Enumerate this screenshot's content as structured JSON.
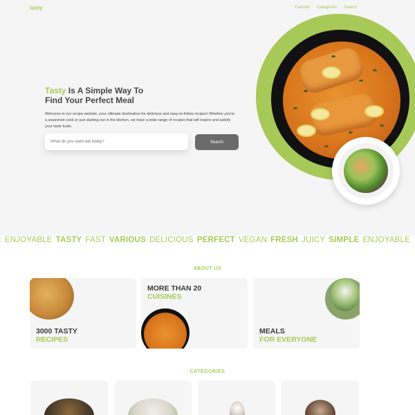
{
  "header": {
    "logo": "tasty",
    "nav": [
      "Favorite",
      "Categories",
      "Search"
    ]
  },
  "hero": {
    "title_accent": "Tasty",
    "title_line1_rest": " Is A Simple Way To",
    "title_line2": "Find Your Perfect Meal",
    "description": "Welcome to our recipe website, your ultimate destination for delicious and easy-to-follow recipes! Whether you're a seasoned cook or just starting out in the kitchen, we have a wide range of recipes that will inspire and satisfy your taste buds.",
    "search_placeholder": "What do you want eat today?",
    "search_button": "Search"
  },
  "marquee": [
    {
      "text": "E",
      "bold": false
    },
    {
      "text": "ENJOYABLE",
      "bold": false
    },
    {
      "text": "TASTY",
      "bold": true
    },
    {
      "text": "FAST",
      "bold": false
    },
    {
      "text": "VARIOUS",
      "bold": true
    },
    {
      "text": "DELICIOUS",
      "bold": false
    },
    {
      "text": "PERFECT",
      "bold": true
    },
    {
      "text": "VEGAN",
      "bold": false
    },
    {
      "text": "FRESH",
      "bold": true
    },
    {
      "text": "JUICY",
      "bold": false
    },
    {
      "text": "SIMPLE",
      "bold": true
    },
    {
      "text": "ENJOYABLE",
      "bold": false
    }
  ],
  "about": {
    "label": "ABOUT US",
    "cards": [
      {
        "line1": "3000 TASTY",
        "line2": "RECIPES"
      },
      {
        "line1": "MORE THAN 20",
        "line2": "CUISINES"
      },
      {
        "line1": "MEALS",
        "line2": "FOR EVERYONE"
      }
    ]
  },
  "categories": {
    "label": "CATEGORIES"
  },
  "colors": {
    "accent": "#a7c957",
    "button": "#6b6b6b",
    "background": "#f5f5f5"
  }
}
